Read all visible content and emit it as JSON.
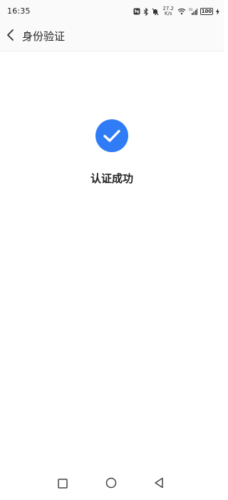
{
  "status_bar": {
    "time": "16:35",
    "net_speed_value": "27.2",
    "net_speed_unit": "K/s",
    "battery_level": "100",
    "icons": [
      "nfc-icon",
      "bluetooth-icon",
      "mute-icon",
      "wifi-icon",
      "signal-icon",
      "battery-icon",
      "charging-icon"
    ]
  },
  "header": {
    "title": "身份验证",
    "back_icon": "chevron-left-icon"
  },
  "main": {
    "result_text": "认证成功",
    "result_icon": "check-circle-icon",
    "accent_color": "#2f7cf6"
  },
  "system_nav": {
    "recent_icon": "square-icon",
    "home_icon": "circle-icon",
    "back_icon": "triangle-back-icon"
  }
}
